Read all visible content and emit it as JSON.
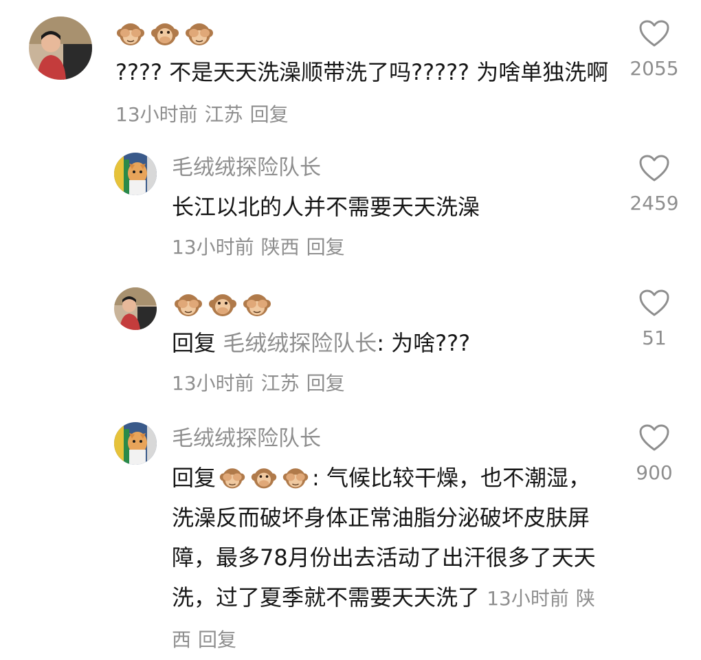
{
  "comments": [
    {
      "author_emoji": [
        "see-no-evil-monkey",
        "speak-no-evil-monkey",
        "see-no-evil-monkey"
      ],
      "text": "???? 不是天天洗澡顺带洗了吗????? 为啥单独洗啊",
      "time": "13小时前",
      "location": "江苏",
      "reply_label": "回复",
      "likes": "2055"
    },
    {
      "author": "毛绒绒探险队长",
      "text": "长江以北的人并不需要天天洗澡",
      "time": "13小时前",
      "location": "陕西",
      "reply_label": "回复",
      "likes": "2459"
    },
    {
      "author_emoji": [
        "see-no-evil-monkey",
        "speak-no-evil-monkey",
        "see-no-evil-monkey"
      ],
      "reply_prefix": "回复",
      "mention": "毛绒绒探险队长",
      "text": ": 为啥???",
      "time": "13小时前",
      "location": "江苏",
      "reply_label": "回复",
      "likes": "51"
    },
    {
      "author": "毛绒绒探险队长",
      "reply_prefix": "回复",
      "text": ": 气候比较干燥，也不潮湿，洗澡反而破坏身体正常油脂分泌破坏皮肤屏障，最多78月份出去活动了出汗很多了天天洗，过了夏季就不需要天天洗了",
      "time": "13小时前",
      "location": "陕西",
      "reply_label": "回复",
      "likes": "900"
    }
  ],
  "colors": {
    "text": "#161616",
    "secondary": "#8e8e8e",
    "background": "#ffffff"
  }
}
